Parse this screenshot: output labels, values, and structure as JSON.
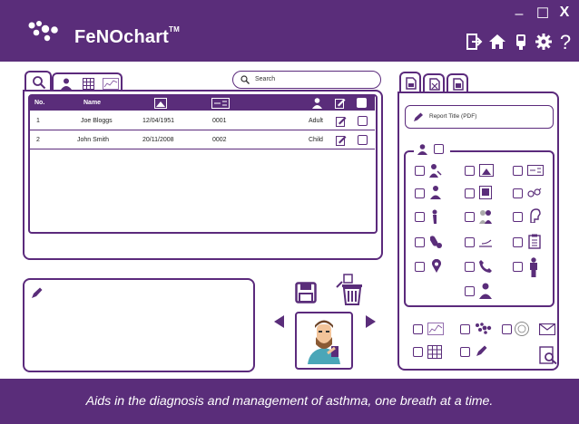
{
  "app": {
    "name": "FeNOchart",
    "tm": "TM"
  },
  "window": {
    "minimize": "–",
    "maximize": "☐",
    "close": "X"
  },
  "search": {
    "placeholder": "Search"
  },
  "patients_table": {
    "columns": [
      "No.",
      "Name",
      "",
      "",
      "",
      "",
      ""
    ],
    "rows": [
      {
        "no": "1",
        "name": "Joe Bloggs",
        "dob": "12/04/1951",
        "id": "0001",
        "type": "Adult"
      },
      {
        "no": "2",
        "name": "John Smith",
        "dob": "20/11/2008",
        "id": "0002",
        "type": "Child"
      }
    ]
  },
  "report": {
    "title": "Report Title (PDF)"
  },
  "footer": {
    "tagline": "Aids in the diagnosis and management of asthma, one breath at a time."
  },
  "colors": {
    "brand": "#5a2d7a"
  },
  "icons": {
    "header": [
      "logout-icon",
      "home-icon",
      "device-icon",
      "settings-icon",
      "help-icon"
    ],
    "tabs_left": [
      "search-icon",
      "person-icon",
      "grid-icon",
      "chart-icon"
    ],
    "tabs_right": [
      "document-icon",
      "spreadsheet-icon",
      "pdf-icon"
    ]
  }
}
